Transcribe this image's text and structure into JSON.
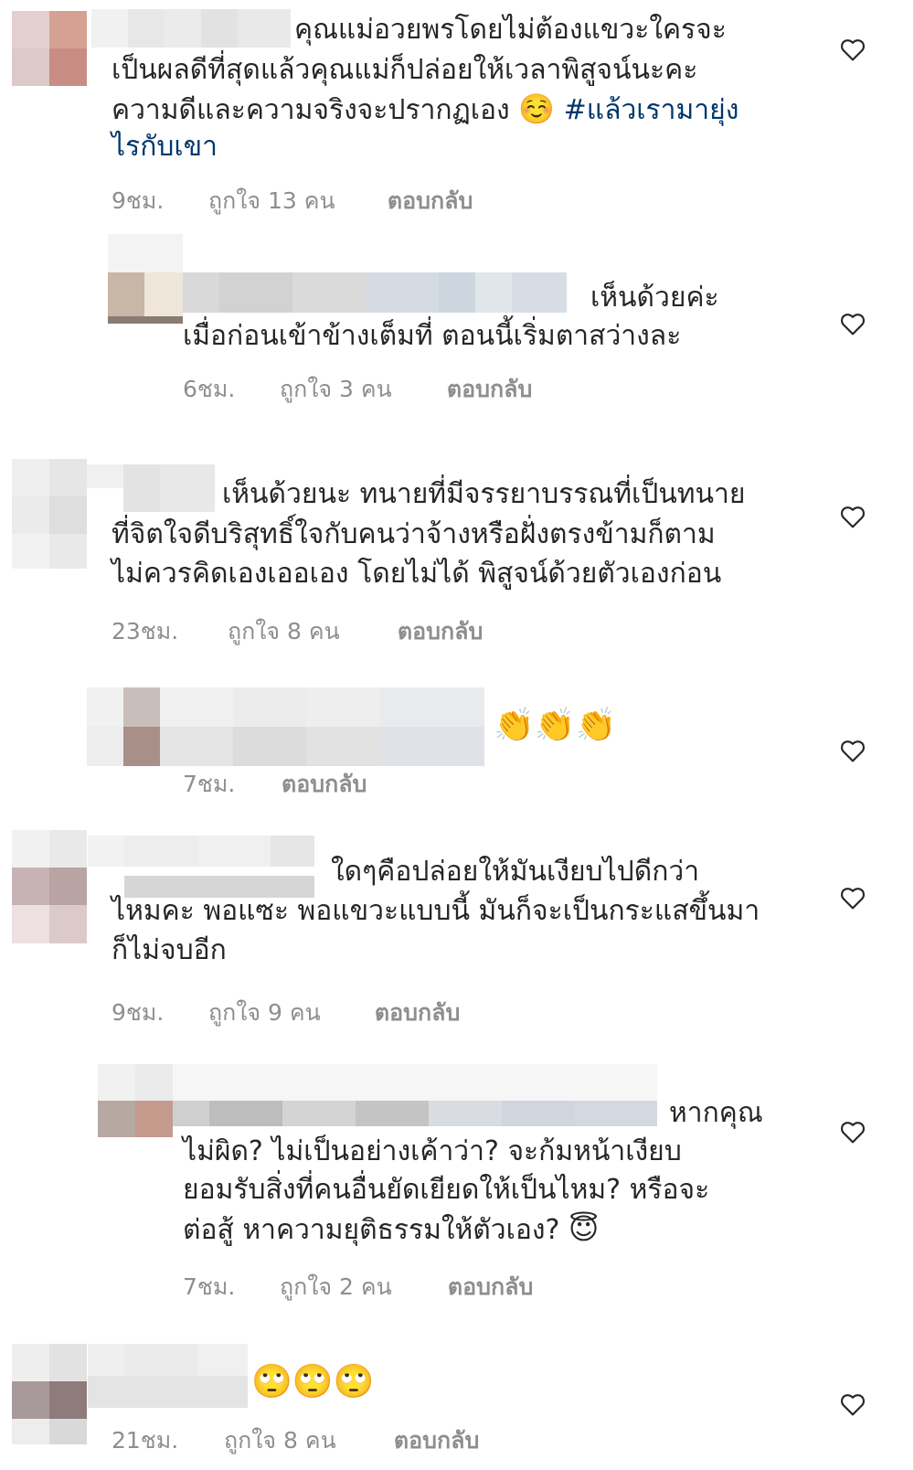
{
  "comments": [
    {
      "text_lines": [
        "คุณแม่อวยพรโดยไม่ต้องแขวะใครจะ",
        "เป็นผลดีที่สุดแล้วคุณแม่ก็ปล่อยให้เวลาพิสูจน์นะคะ",
        "ความดีและความจริงจะปรากฏเอง"
      ],
      "emoji": "☺️",
      "hashtag_a": "#แล้วเรามายุ่ง",
      "hashtag_b": "ไรกับเขา",
      "time": "9ชม.",
      "likes": "ถูกใจ 13 คน",
      "reply": "ตอบกลับ"
    },
    {
      "text_lines": [
        "เห็นด้วยค่ะ",
        "เมื่อก่อนเข้าข้างเต็มที่ ตอนนี้เริ่มตาสว่างละ"
      ],
      "time": "6ชม.",
      "likes": "ถูกใจ 3 คน",
      "reply": "ตอบกลับ"
    },
    {
      "text_lines": [
        "เห็นด้วยนะ ทนายที่มีจรรยาบรรณที่เป็นทนาย",
        "ที่จิตใจดีบริสุทธิ์ใจกับคนว่าจ้างหรือฝั่งตรงข้ามก็ตาม",
        "ไม่ควรคิดเองเออเอง โดยไม่ได้ พิสูจน์ด้วยตัวเองก่อน"
      ],
      "time": "23ชม.",
      "likes": "ถูกใจ 8 คน",
      "reply": "ตอบกลับ"
    },
    {
      "emoji": "👏👏👏",
      "time": "7ชม.",
      "reply": "ตอบกลับ"
    },
    {
      "text_lines": [
        "ใดๆคือปล่อยให้มันเงียบไปดีกว่า",
        "ไหมคะ พอแซะ พอแขวะแบบนี้ มันก็จะเป็นกระแสขึ้นมา",
        "ก็ไม่จบอีก"
      ],
      "time": "9ชม.",
      "likes": "ถูกใจ 9 คน",
      "reply": "ตอบกลับ"
    },
    {
      "text_lines": [
        "หากคุณ",
        "ไม่ผิด? ไม่เป็นอย่างเค้าว่า? จะก้มหน้าเงียบ",
        "ยอมรับสิ่งที่คนอื่นยัดเยียดให้เป็นไหม? หรือจะ",
        "ต่อสู้ หาความยุติธรรมให้ตัวเอง?"
      ],
      "emoji": "😇",
      "time": "7ชม.",
      "likes": "ถูกใจ 2 คน",
      "reply": "ตอบกลับ"
    },
    {
      "emoji": "🙄🙄🙄",
      "time": "21ชม.",
      "likes": "ถูกใจ 8 คน",
      "reply": "ตอบกลับ"
    }
  ]
}
